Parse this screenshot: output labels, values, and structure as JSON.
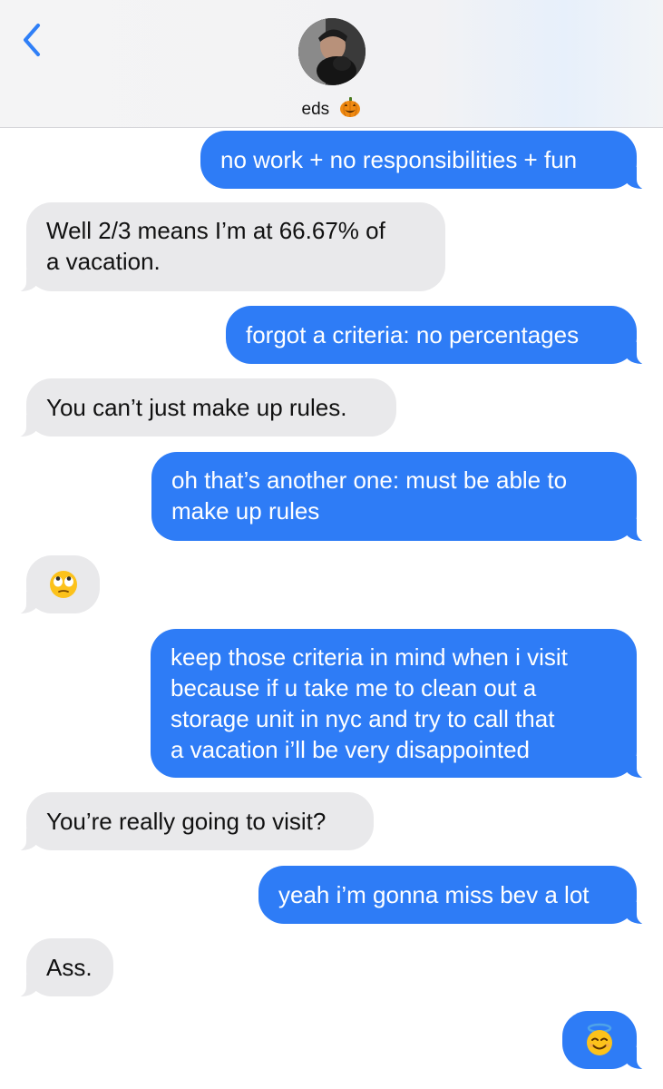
{
  "header": {
    "back_label": "back",
    "contact_name": "eds",
    "name_emoji": "pumpkin-icon"
  },
  "messages": [
    {
      "side": "out",
      "text": "no work + no responsibilities + fun"
    },
    {
      "side": "in",
      "text": "Well 2/3 means I’m at 66.67% of\na vacation."
    },
    {
      "side": "out",
      "text": "forgot a criteria: no percentages"
    },
    {
      "side": "in",
      "text": "You can’t just make up rules."
    },
    {
      "side": "out",
      "text": "oh that’s another one: must be able to\nmake up rules"
    },
    {
      "side": "in",
      "emoji": "eye-roll-emoji"
    },
    {
      "side": "out",
      "text": "keep those criteria in mind when i visit\nbecause if u take me to clean out a\nstorage unit in nyc and try to call that\na vacation i’ll be very disappointed"
    },
    {
      "side": "in",
      "text": "You’re really going to visit?"
    },
    {
      "side": "out",
      "text": "yeah i’m gonna miss bev a lot"
    },
    {
      "side": "in",
      "text": "Ass."
    },
    {
      "side": "out",
      "emoji": "halo-smile-emoji"
    }
  ],
  "colors": {
    "outgoing": "#2e7cf6",
    "incoming": "#e9e9eb",
    "accent": "#2f7ff7"
  }
}
